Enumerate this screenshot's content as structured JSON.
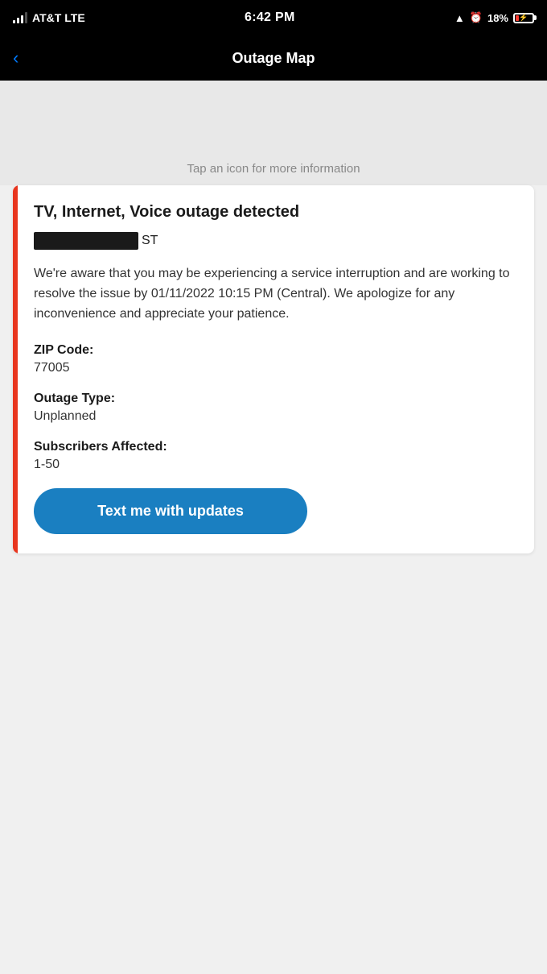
{
  "statusBar": {
    "carrier": "AT&T",
    "networkType": "LTE",
    "time": "6:42 PM",
    "batteryPercent": "18%",
    "locationActive": true,
    "alarmActive": true
  },
  "navBar": {
    "title": "Outage Map",
    "backLabel": "‹"
  },
  "mapArea": {
    "tapHint": "Tap an icon for more information"
  },
  "card": {
    "outageTitle": "TV, Internet, Voice outage detected",
    "addressSuffix": "ST",
    "description": "We're aware that you may be experiencing a service interruption and are working to resolve the issue by 01/11/2022 10:15 PM (Central). We apologize for any inconvenience and appreciate your patience.",
    "zipCodeLabel": "ZIP Code:",
    "zipCodeValue": "77005",
    "outageTypeLabel": "Outage Type:",
    "outageTypeValue": "Unplanned",
    "subscribersLabel": "Subscribers Affected:",
    "subscribersValue": "1-50",
    "textButtonLabel": "Text me with updates"
  }
}
